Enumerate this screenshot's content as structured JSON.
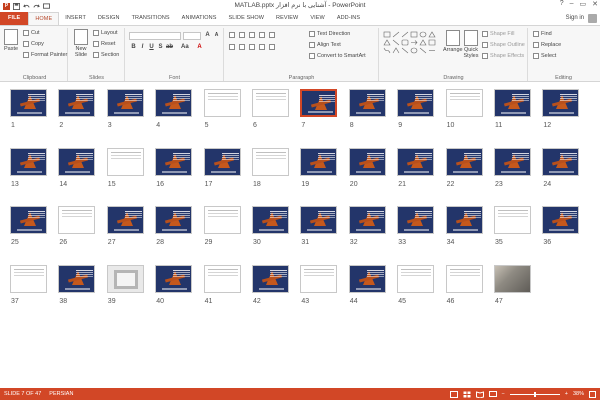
{
  "title_bar": {
    "title": "MATLAB.pptx آشنایی با نرم افزار - PowerPoint",
    "help": "?",
    "minimize": "–",
    "restore": "▭",
    "close": "✕"
  },
  "tabs": [
    "FILE",
    "HOME",
    "INSERT",
    "DESIGN",
    "TRANSITIONS",
    "ANIMATIONS",
    "SLIDE SHOW",
    "REVIEW",
    "VIEW",
    "ADD-INS"
  ],
  "active_tab": "HOME",
  "sign_in": "Sign in",
  "ribbon": {
    "clipboard": {
      "label": "Clipboard",
      "paste": "Paste",
      "cut": "Cut",
      "copy": "Copy",
      "format_painter": "Format Painter"
    },
    "slides": {
      "label": "Slides",
      "new_slide": "New Slide",
      "layout": "Layout",
      "reset": "Reset",
      "section": "Section"
    },
    "font": {
      "label": "Font"
    },
    "paragraph": {
      "label": "Paragraph",
      "text_direction": "Text Direction",
      "align_text": "Align Text",
      "convert_smartart": "Convert to SmartArt"
    },
    "drawing": {
      "label": "Drawing",
      "arrange": "Arrange",
      "quick_styles": "Quick Styles",
      "shape_fill": "Shape Fill",
      "shape_outline": "Shape Outline",
      "shape_effects": "Shape Effects"
    },
    "editing": {
      "label": "Editing",
      "find": "Find",
      "replace": "Replace",
      "select": "Select"
    }
  },
  "slides": [
    {
      "n": "1",
      "kind": "dark"
    },
    {
      "n": "2",
      "kind": "dark"
    },
    {
      "n": "3",
      "kind": "dark"
    },
    {
      "n": "4",
      "kind": "dark"
    },
    {
      "n": "5",
      "kind": "white"
    },
    {
      "n": "6",
      "kind": "white"
    },
    {
      "n": "7",
      "kind": "dark",
      "selected": true
    },
    {
      "n": "8",
      "kind": "dark"
    },
    {
      "n": "9",
      "kind": "dark"
    },
    {
      "n": "10",
      "kind": "white"
    },
    {
      "n": "11",
      "kind": "dark"
    },
    {
      "n": "12",
      "kind": "dark"
    },
    {
      "n": "13",
      "kind": "dark"
    },
    {
      "n": "14",
      "kind": "dark"
    },
    {
      "n": "15",
      "kind": "white"
    },
    {
      "n": "16",
      "kind": "dark"
    },
    {
      "n": "17",
      "kind": "dark"
    },
    {
      "n": "18",
      "kind": "white"
    },
    {
      "n": "19",
      "kind": "dark"
    },
    {
      "n": "20",
      "kind": "dark"
    },
    {
      "n": "21",
      "kind": "dark"
    },
    {
      "n": "22",
      "kind": "dark"
    },
    {
      "n": "23",
      "kind": "dark"
    },
    {
      "n": "24",
      "kind": "dark"
    },
    {
      "n": "25",
      "kind": "dark"
    },
    {
      "n": "26",
      "kind": "white"
    },
    {
      "n": "27",
      "kind": "dark"
    },
    {
      "n": "28",
      "kind": "dark"
    },
    {
      "n": "29",
      "kind": "white"
    },
    {
      "n": "30",
      "kind": "dark"
    },
    {
      "n": "31",
      "kind": "dark"
    },
    {
      "n": "32",
      "kind": "dark"
    },
    {
      "n": "33",
      "kind": "dark"
    },
    {
      "n": "34",
      "kind": "dark"
    },
    {
      "n": "35",
      "kind": "white"
    },
    {
      "n": "36",
      "kind": "dark"
    },
    {
      "n": "37",
      "kind": "white"
    },
    {
      "n": "38",
      "kind": "dark"
    },
    {
      "n": "39",
      "kind": "grey"
    },
    {
      "n": "40",
      "kind": "dark"
    },
    {
      "n": "41",
      "kind": "white"
    },
    {
      "n": "42",
      "kind": "dark"
    },
    {
      "n": "43",
      "kind": "white"
    },
    {
      "n": "44",
      "kind": "dark"
    },
    {
      "n": "45",
      "kind": "white"
    },
    {
      "n": "46",
      "kind": "white"
    },
    {
      "n": "47",
      "kind": "photo"
    }
  ],
  "status_bar": {
    "slide_info": "SLIDE 7 OF 47",
    "language": "PERSIAN",
    "zoom": "38%"
  },
  "colors": {
    "accent": "#d24726",
    "slide_bg": "#23356a"
  }
}
